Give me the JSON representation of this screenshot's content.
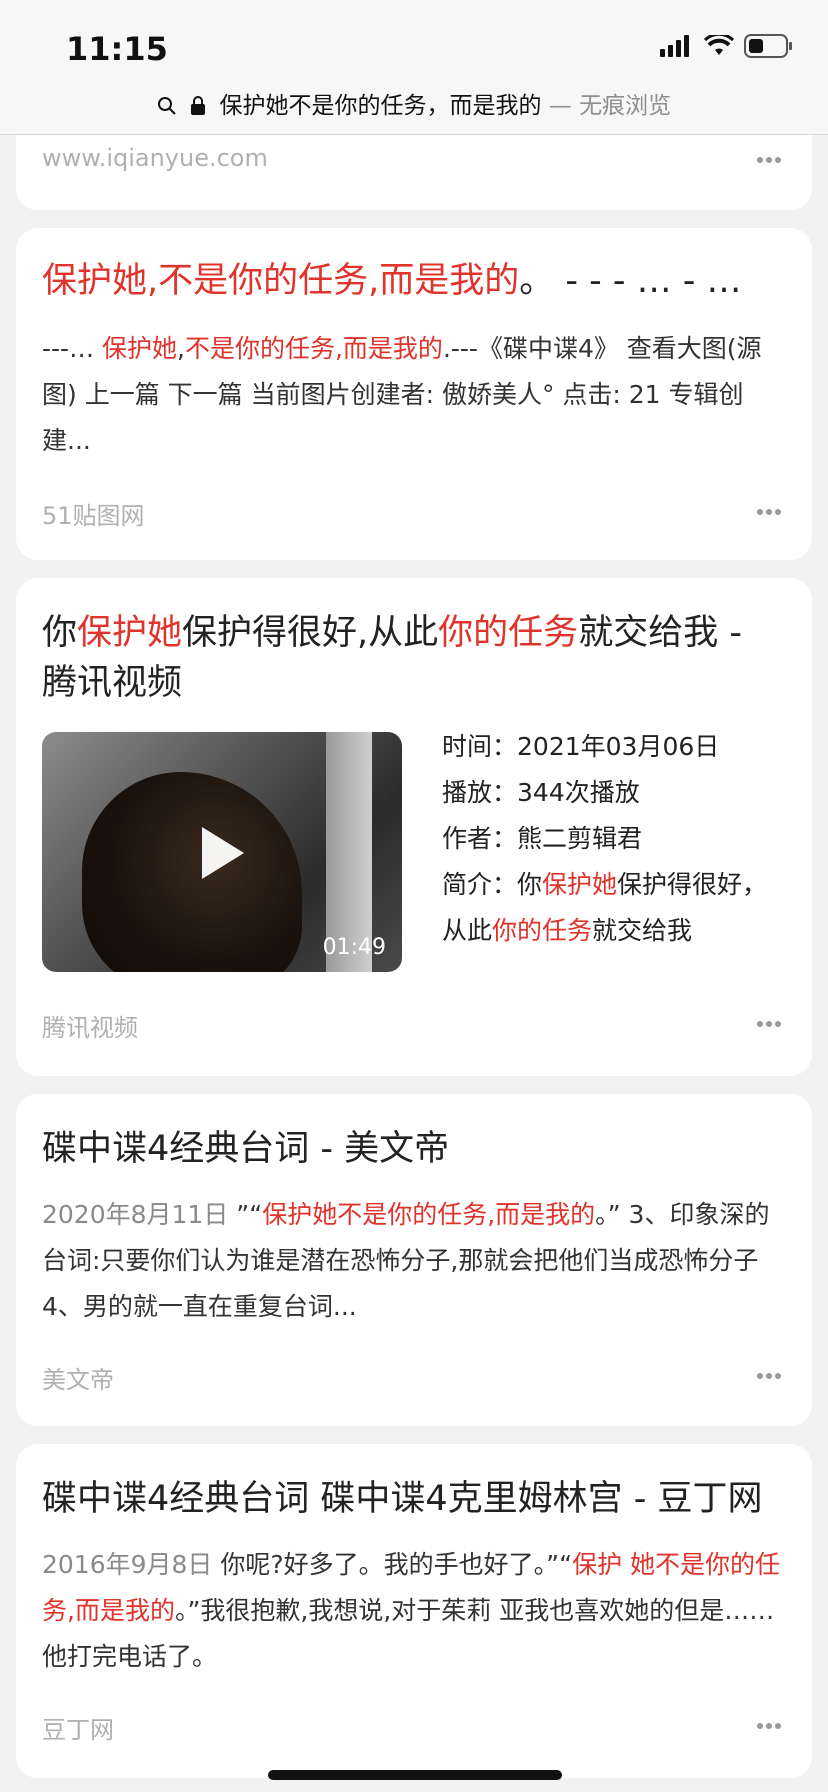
{
  "status_bar": {
    "time": "11:15",
    "url_prefix": "保护她不是你的任务，而是我的",
    "url_suffix": " — 无痕浏览",
    "search_icon": "search-icon",
    "lock_icon": "lock-icon",
    "signal_icon": "cellular-signal-icon",
    "wifi_icon": "wifi-icon",
    "battery_icon": "battery-icon"
  },
  "results": [
    {
      "source": "www.iqianyue.com"
    },
    {
      "title_red": "保护她,不是你的任务,而是我的",
      "title_rest": "。 - - - … - …",
      "snippet": [
        {
          "t": "---… ",
          "red": false
        },
        {
          "t": "保护她",
          "red": true
        },
        {
          "t": ",",
          "red": false
        },
        {
          "t": "不是你的任务,而是我的",
          "red": true
        },
        {
          "t": ".---《碟中谍4》 查看大图(源图) 上一篇 下一篇 当前图片创建者: 傲娇美人° 点击: 21 专辑创建...",
          "red": false
        }
      ],
      "source": "51贴图网"
    },
    {
      "title": [
        {
          "t": "你",
          "red": false
        },
        {
          "t": "保护她",
          "red": true
        },
        {
          "t": "保护得很好,从此",
          "red": false
        },
        {
          "t": "你的任务",
          "red": true
        },
        {
          "t": "就交给我 - 腾讯视频",
          "red": false
        }
      ],
      "video": {
        "duration": "01:49",
        "play_icon": "play-icon"
      },
      "meta": {
        "time_label": "时间：",
        "time_value": "2021年03月06日",
        "plays_label": "播放：",
        "plays_value": "344次播放",
        "author_label": "作者：",
        "author_value": "熊二剪辑君",
        "intro_label": "简介：",
        "intro": [
          {
            "t": "你",
            "red": false
          },
          {
            "t": "保护她",
            "red": true
          },
          {
            "t": "保护得很好，从此",
            "red": false
          },
          {
            "t": "你的任务",
            "red": true
          },
          {
            "t": "就交给我",
            "red": false
          }
        ]
      },
      "source": "腾讯视频"
    },
    {
      "title": "碟中谍4经典台词 - 美文帝",
      "date": "2020年8月11日",
      "snippet": [
        {
          "t": " ”“",
          "red": false
        },
        {
          "t": "保护她不是你的任务,而是我的",
          "red": true
        },
        {
          "t": "。” 3、印象深的台词:只要你们认为谁是潜在恐怖分子,那就会把他们当成恐怖分子 4、男的就一直在重复台词...",
          "red": false
        }
      ],
      "source": "美文帝"
    },
    {
      "title": "碟中谍4经典台词 碟中谍4克里姆林宫 - 豆丁网",
      "date": "2016年9月8日",
      "snippet": [
        {
          "t": " 你呢?好多了。我的手也好了。”“",
          "red": false
        },
        {
          "t": "保护 她不是你的任务,而是我的",
          "red": true
        },
        {
          "t": "。”我很抱歉,我想说,对于茱莉 亚我也喜欢她的但是……他打完电话了。",
          "red": false
        }
      ],
      "source": "豆丁网"
    }
  ]
}
